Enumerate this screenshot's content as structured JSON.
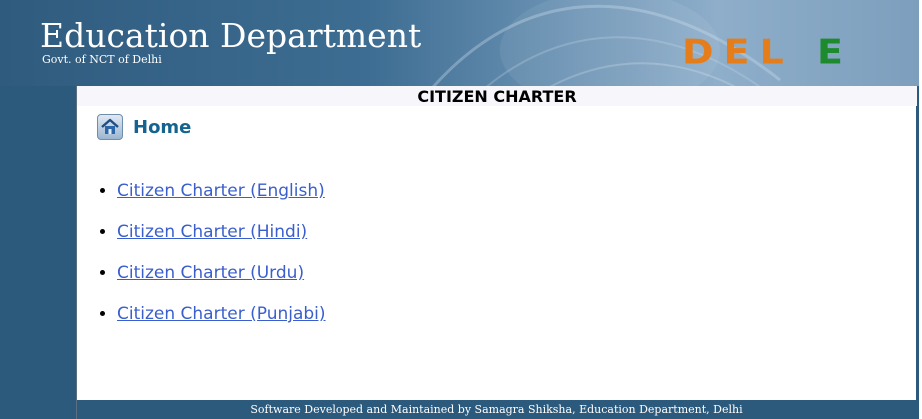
{
  "header": {
    "title": "Education Department",
    "subtitle": "Govt. of NCT of Delhi",
    "logo_part1": "DEL",
    "logo_part2": "E",
    "colors": {
      "banner": "#2f5b7e",
      "logo_orange": "#e57d1a",
      "logo_green": "#1d8a2d"
    }
  },
  "page": {
    "title": "CITIZEN CHARTER",
    "home_label": "Home",
    "home_icon": "home-icon"
  },
  "links": [
    {
      "label": "Citizen Charter (English)"
    },
    {
      "label": "Citizen Charter (Hindi)"
    },
    {
      "label": "Citizen Charter (Urdu)"
    },
    {
      "label": "Citizen Charter (Punjabi)"
    }
  ],
  "footer": {
    "text": "Software Developed and Maintained by Samagra Shiksha, Education Department, Delhi"
  }
}
